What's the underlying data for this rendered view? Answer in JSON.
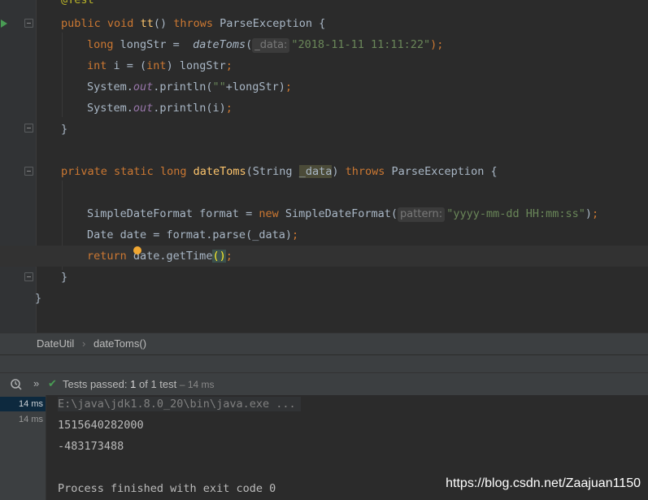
{
  "editor": {
    "lines": {
      "annotation": "@Test",
      "tt_public": "public",
      "tt_void": "void",
      "tt_name": "tt",
      "tt_parens": "()",
      "tt_throws": "throws",
      "tt_exception": "ParseException {",
      "l3_type": "long",
      "l3_rest": "longStr =",
      "l3_call": "dateToms",
      "l3_open": "(",
      "l3_hint": "_data:",
      "l3_string": "\"2018-11-11 11:11:22\"",
      "l3_close": ");",
      "l4_type": "int",
      "l4_mid": "i = (",
      "l4_cast": "int",
      "l4_end": ") longStr",
      "l4_semi": ";",
      "l5_sys": "System.",
      "l5_out": "out",
      "l5_mid": ".println(",
      "l5_str": "\"\"",
      "l5_end": "+longStr)",
      "l5_semi": ";",
      "l6_sys": "System.",
      "l6_out": "out",
      "l6_end": ".println(i)",
      "l6_semi": ";",
      "l7_brace": "}",
      "m_private": "private",
      "m_static": "static",
      "m_long": "long",
      "m_name": "dateToms",
      "m_open": "(String ",
      "m_param": "_data",
      "m_close": ")",
      "m_throws": "throws",
      "m_exception": "ParseException {",
      "sdf_decl": "SimpleDateFormat format = ",
      "sdf_new": "new",
      "sdf_ctor": " SimpleDateFormat(",
      "sdf_hint": "pattern:",
      "sdf_string": "\"yyyy-mm-dd HH:mm:ss\"",
      "sdf_close": ")",
      "sdf_semi": ";",
      "date_stmt": "Date date = format.parse(_data)",
      "date_semi": ";",
      "ret_kw": "return",
      "ret_rest": " date.getTime",
      "ret_parens": "()",
      "ret_semi": ";",
      "m_end": "}",
      "class_end": "}"
    }
  },
  "breadcrumb": {
    "class_name": "DateUtil",
    "separator": "›",
    "method_name": "dateToms()"
  },
  "run": {
    "status_prefix": "Tests passed:",
    "passed": "1",
    "of_text": "of 1 test",
    "duration_text": "– 14 ms",
    "expand_glyph": "»",
    "check_glyph": "✔"
  },
  "test_tree": [
    {
      "time": "14 ms",
      "selected": true
    },
    {
      "time": "14 ms",
      "selected": false
    }
  ],
  "console": {
    "command": "E:\\java\\jdk1.8.0_20\\bin\\java.exe ...",
    "output_1": "1515640282000",
    "output_2": "-483173488",
    "finish": "Process finished with exit code 0"
  },
  "watermark": "https://blog.csdn.net/Zaajuan1150",
  "colors": {
    "keyword": "#cc7832",
    "method": "#ffc66d",
    "string": "#6a8759",
    "annotation": "#bbb529",
    "field": "#9876aa",
    "pass_green": "#499c54"
  }
}
